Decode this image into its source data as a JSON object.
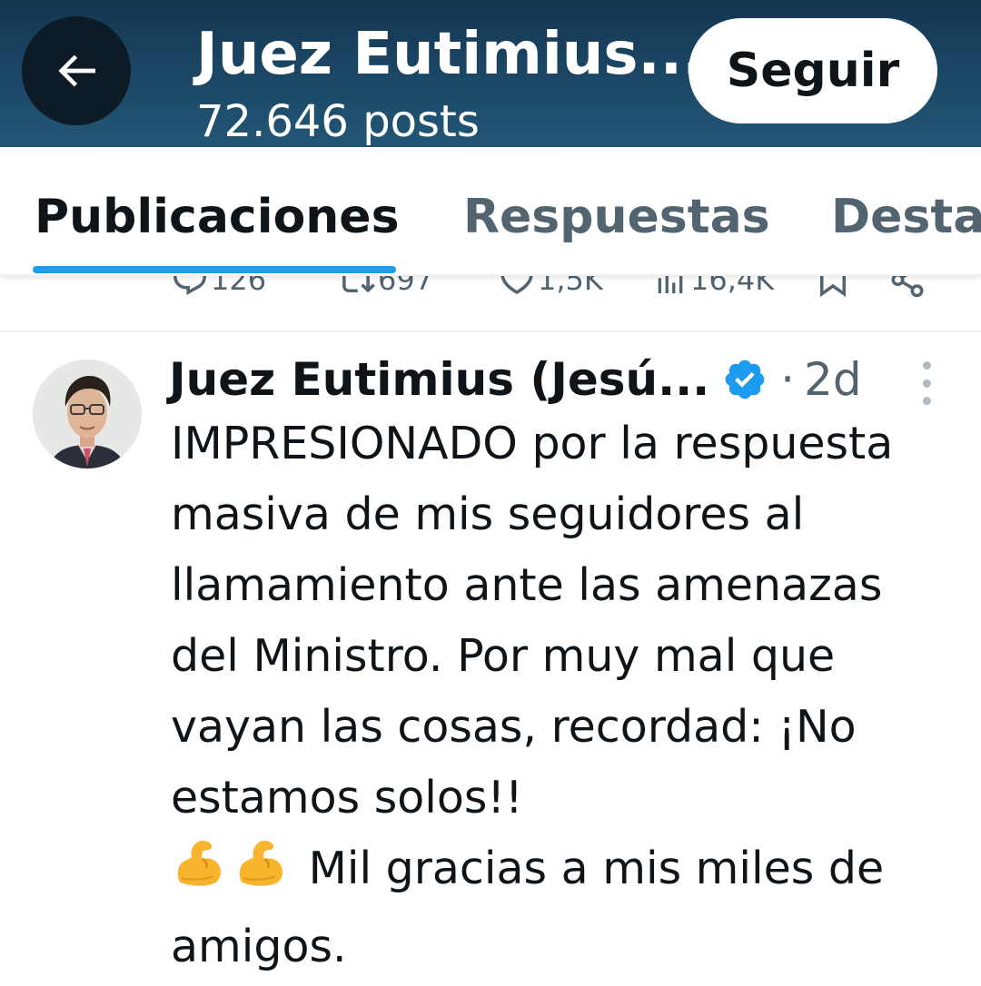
{
  "header": {
    "back_icon": "arrow-left-icon",
    "title": "Juez Eutimius...",
    "subtitle": "72.646 posts",
    "follow_label": "Seguir",
    "background_color": "#1a4563"
  },
  "tabs": [
    {
      "label": "Publicaciones",
      "active": true
    },
    {
      "label": "Respuestas",
      "active": false
    },
    {
      "label": "Desta",
      "active": false
    }
  ],
  "accent_color": "#1d9bf0",
  "previous_post_actions": {
    "replies": "126",
    "reposts": "697",
    "likes": "1,5K",
    "views": "16,4K"
  },
  "post": {
    "author": "Juez Eutimius (Jesú...",
    "verified": true,
    "separator": "·",
    "time": "2d",
    "text": "IMPRESIONADO por la respuesta masiva de mis seguidores al llamamiento ante las amenazas del Ministro. Por muy mal que vayan las cosas, recordad: ¡No estamos solos!!",
    "emojis": [
      "flexed-biceps",
      "flexed-biceps"
    ],
    "text_after_emojis": "Mil gracias a mis miles de amigos."
  }
}
